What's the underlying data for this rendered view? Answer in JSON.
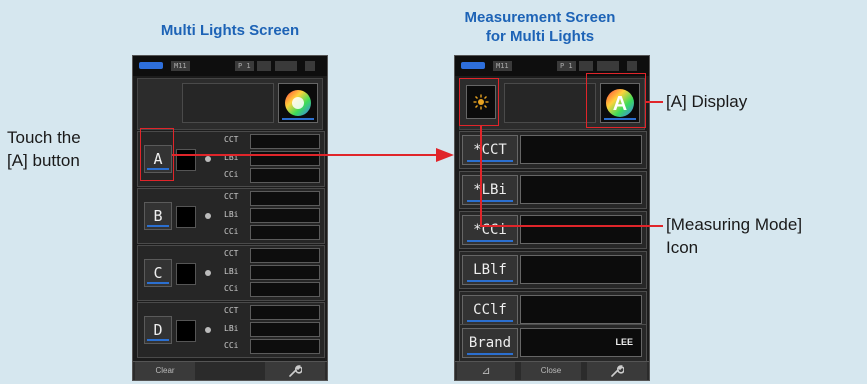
{
  "headings": {
    "left": "Multi Lights Screen",
    "right_line1": "Measurement Screen",
    "right_line2": "for Multi Lights"
  },
  "annotations": {
    "touch_line1": "Touch the",
    "touch_line2": "[A] button",
    "a_display": "[A] Display",
    "mode_line1": "[Measuring Mode]",
    "mode_line2": "Icon"
  },
  "left_screen": {
    "status": {
      "memory": "M11",
      "page": "P 1"
    },
    "lights": [
      {
        "button": "A",
        "labels": [
          "CCT",
          "LBi",
          "CCi"
        ]
      },
      {
        "button": "B",
        "labels": [
          "CCT",
          "LBi",
          "CCi"
        ]
      },
      {
        "button": "C",
        "labels": [
          "CCT",
          "LBi",
          "CCi"
        ]
      },
      {
        "button": "D",
        "labels": [
          "CCT",
          "LBi",
          "CCi"
        ]
      }
    ],
    "bottom": {
      "clear": "Clear",
      "tool_icon": "wrench-icon"
    }
  },
  "right_screen": {
    "status": {
      "memory": "M11",
      "page": "P 1"
    },
    "mode_icon": "ambient-light-icon",
    "display_letter": "A",
    "rows": [
      {
        "label": "*CCT",
        "value": ""
      },
      {
        "label": "*LBi",
        "value": ""
      },
      {
        "label": "*CCi",
        "value": ""
      },
      {
        "label": "LBlf",
        "value": ""
      },
      {
        "label": "CClf",
        "value": ""
      },
      {
        "label": "Brand",
        "value": "LEE"
      }
    ],
    "bottom": {
      "delta": "⊿",
      "close": "Close",
      "tool_icon": "wrench-icon"
    }
  },
  "colors": {
    "accent_blue": "#1d63b6",
    "highlight_red": "#e0252a",
    "background": "#d6e7ef"
  }
}
